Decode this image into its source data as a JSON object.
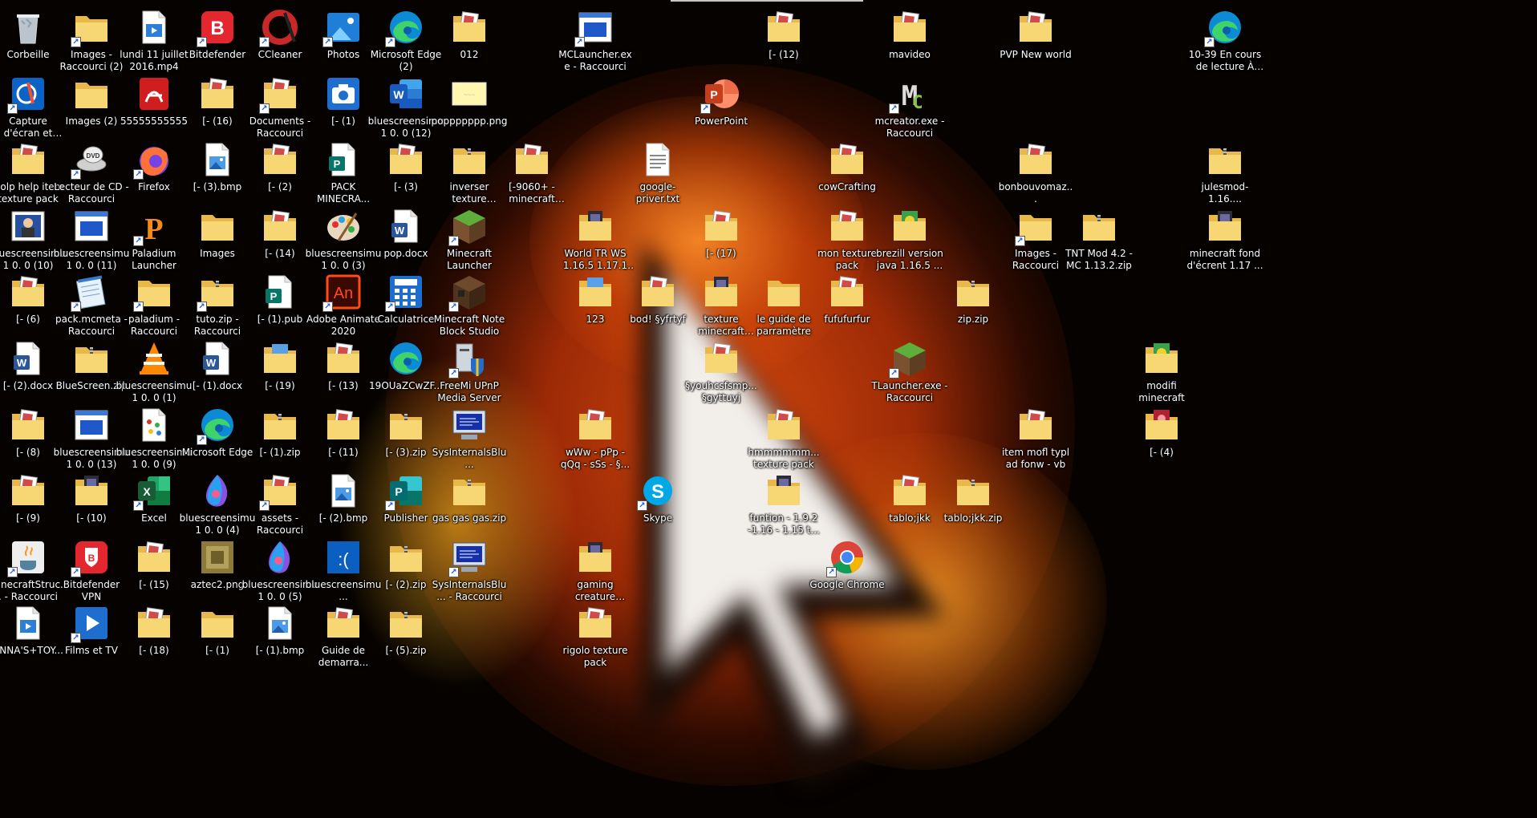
{
  "icons": [
    {
      "label": "Corbeille",
      "type": "recycle",
      "col": 0,
      "row": 0,
      "shortcut": false
    },
    {
      "label": "Images - Raccourci (2)",
      "type": "folder-img",
      "col": 1,
      "row": 0,
      "shortcut": true
    },
    {
      "label": "lundi 11 juillet 2016.mp4",
      "type": "video",
      "col": 2,
      "row": 0,
      "shortcut": false
    },
    {
      "label": "Bitdefender",
      "type": "bitdefender",
      "col": 3,
      "row": 0,
      "shortcut": true
    },
    {
      "label": "CCleaner",
      "type": "ccleaner",
      "col": 4,
      "row": 0,
      "shortcut": true
    },
    {
      "label": "Photos",
      "type": "photos",
      "col": 5,
      "row": 0,
      "shortcut": true
    },
    {
      "label": "Microsoft Edge (2)",
      "type": "edge",
      "col": 6,
      "row": 0,
      "shortcut": true
    },
    {
      "label": "012",
      "type": "folder-doc",
      "col": 7,
      "row": 0,
      "shortcut": false
    },
    {
      "label": "MCLauncher.exe - Raccourci",
      "type": "app-window",
      "col": 9,
      "row": 0,
      "shortcut": true
    },
    {
      "label": "[- (12)",
      "type": "folder-doc",
      "col": 12,
      "row": 0,
      "shortcut": false
    },
    {
      "label": "mavideo",
      "type": "folder-doc",
      "col": 14,
      "row": 0,
      "shortcut": false
    },
    {
      "label": "PVP New world",
      "type": "folder-doc",
      "col": 16,
      "row": 0,
      "shortcut": false
    },
    {
      "label": "10-39 En cours de lecture À re...",
      "type": "edge",
      "col": 19,
      "row": 0,
      "shortcut": true
    },
    {
      "label": "Capture d'écran et croquis",
      "type": "snip",
      "col": 0,
      "row": 1,
      "shortcut": true
    },
    {
      "label": "Images (2)",
      "type": "folder",
      "col": 1,
      "row": 1,
      "shortcut": false
    },
    {
      "label": "55555555555",
      "type": "pdf",
      "col": 2,
      "row": 1,
      "shortcut": false
    },
    {
      "label": "[- (16)",
      "type": "folder-doc",
      "col": 3,
      "row": 1,
      "shortcut": false
    },
    {
      "label": "Documents - Raccourci",
      "type": "folder-doc",
      "col": 4,
      "row": 1,
      "shortcut": true
    },
    {
      "label": "[- (1)",
      "type": "camera",
      "col": 5,
      "row": 1,
      "shortcut": false
    },
    {
      "label": "bluescreensimu 1 0. 0 (12)",
      "type": "word",
      "col": 6,
      "row": 1,
      "shortcut": false
    },
    {
      "label": "poppppppp.png",
      "type": "png-yellow",
      "col": 7,
      "row": 1,
      "shortcut": false
    },
    {
      "label": "PowerPoint",
      "type": "powerpoint",
      "col": 11,
      "row": 1,
      "shortcut": true
    },
    {
      "label": "mcreator.exe - Raccourci",
      "type": "mcreator",
      "col": 14,
      "row": 1,
      "shortcut": true
    },
    {
      "label": "wolp help item texture pack",
      "type": "folder-doc",
      "col": 0,
      "row": 2,
      "shortcut": false
    },
    {
      "label": "Lecteur de CD - Raccourci",
      "type": "dvd",
      "col": 1,
      "row": 2,
      "shortcut": true
    },
    {
      "label": "Firefox",
      "type": "firefox",
      "col": 2,
      "row": 2,
      "shortcut": true
    },
    {
      "label": "[- (3).bmp",
      "type": "image-file",
      "col": 3,
      "row": 2,
      "shortcut": false
    },
    {
      "label": "[- (2)",
      "type": "folder-doc",
      "col": 4,
      "row": 2,
      "shortcut": false
    },
    {
      "label": "PACK MINECRA...",
      "type": "publisher-doc",
      "col": 5,
      "row": 2,
      "shortcut": false
    },
    {
      "label": "[- (3)",
      "type": "folder-doc",
      "col": 6,
      "row": 2,
      "shortcut": false
    },
    {
      "label": "inverser texture pack.zip",
      "type": "zip",
      "col": 7,
      "row": 2,
      "shortcut": false
    },
    {
      "label": "[-9060+ - minecraft cras...",
      "type": "folder-doc",
      "col": 8,
      "row": 2,
      "shortcut": false
    },
    {
      "label": "google-priver.txt",
      "type": "text",
      "col": 10,
      "row": 2,
      "shortcut": false
    },
    {
      "label": "cowCrafting",
      "type": "folder-doc",
      "col": 13,
      "row": 2,
      "shortcut": false
    },
    {
      "label": "bonbouvomaz...",
      "type": "folder-doc",
      "col": 16,
      "row": 2,
      "shortcut": false
    },
    {
      "label": "julesmod-1.16....",
      "type": "zip",
      "col": 19,
      "row": 2,
      "shortcut": false
    },
    {
      "label": "bluescreensimu 1 0. 0 (10)",
      "type": "app-person",
      "col": 0,
      "row": 3,
      "shortcut": false
    },
    {
      "label": "bluescreensimu 1 0. 0 (11)",
      "type": "app-window",
      "col": 1,
      "row": 3,
      "shortcut": false
    },
    {
      "label": "Paladium Launcher",
      "type": "paladium",
      "col": 2,
      "row": 3,
      "shortcut": true
    },
    {
      "label": "Images",
      "type": "folder",
      "col": 3,
      "row": 3,
      "shortcut": false
    },
    {
      "label": "[- (14)",
      "type": "folder-doc",
      "col": 4,
      "row": 3,
      "shortcut": false
    },
    {
      "label": "bluescreensimu 1 0. 0 (3)",
      "type": "paint",
      "col": 5,
      "row": 3,
      "shortcut": false
    },
    {
      "label": "pop.docx",
      "type": "word-doc",
      "col": 6,
      "row": 3,
      "shortcut": false
    },
    {
      "label": "Minecraft Launcher",
      "type": "minecraft",
      "col": 7,
      "row": 3,
      "shortcut": true
    },
    {
      "label": "World TR WS 1.16.5 1.17.1 1...",
      "type": "folder-dark",
      "col": 9,
      "row": 3,
      "shortcut": false
    },
    {
      "label": "[- (17)",
      "type": "folder-doc",
      "col": 11,
      "row": 3,
      "shortcut": false
    },
    {
      "label": "mon texture pack",
      "type": "folder-doc",
      "col": 13,
      "row": 3,
      "shortcut": false
    },
    {
      "label": "brezill version java 1.16.5 ...",
      "type": "folder-green",
      "col": 14,
      "row": 3,
      "shortcut": false
    },
    {
      "label": "Images - Raccourci",
      "type": "folder-img",
      "col": 16,
      "row": 3,
      "shortcut": true
    },
    {
      "label": "TNT Mod 4.2 - MC 1.13.2.zip",
      "type": "zip",
      "col": 17,
      "row": 3,
      "shortcut": false
    },
    {
      "label": "minecraft fond d'écrent 1.17 ...",
      "type": "folder-dark",
      "col": 19,
      "row": 3,
      "shortcut": false
    },
    {
      "label": "[- (6)",
      "type": "folder-doc",
      "col": 0,
      "row": 4,
      "shortcut": false
    },
    {
      "label": "pack.mcmeta - Raccourci",
      "type": "notepad",
      "col": 1,
      "row": 4,
      "shortcut": true
    },
    {
      "label": "paladium - Raccourci",
      "type": "folder",
      "col": 2,
      "row": 4,
      "shortcut": true
    },
    {
      "label": "tuto.zip - Raccourci",
      "type": "zip",
      "col": 3,
      "row": 4,
      "shortcut": true
    },
    {
      "label": "[- (1).pub",
      "type": "publisher-doc",
      "col": 4,
      "row": 4,
      "shortcut": false
    },
    {
      "label": "Adobe Animate 2020",
      "type": "animate",
      "col": 5,
      "row": 4,
      "shortcut": true
    },
    {
      "label": "Calculatrice",
      "type": "calc",
      "col": 6,
      "row": 4,
      "shortcut": true
    },
    {
      "label": "Minecraft Note Block Studio",
      "type": "noteblock",
      "col": 7,
      "row": 4,
      "shortcut": true
    },
    {
      "label": "123",
      "type": "folder-blue",
      "col": 9,
      "row": 4,
      "shortcut": false
    },
    {
      "label": "bod! §yfrtyf",
      "type": "folder-doc",
      "col": 10,
      "row": 4,
      "shortcut": false
    },
    {
      "label": "texture minecraft modifi texture ...",
      "type": "folder-dark",
      "col": 11,
      "row": 4,
      "shortcut": false
    },
    {
      "label": "le guide de parramètre",
      "type": "folder",
      "col": 12,
      "row": 4,
      "shortcut": false
    },
    {
      "label": "fufufurfur",
      "type": "folder-doc",
      "col": 13,
      "row": 4,
      "shortcut": false
    },
    {
      "label": "zip.zip",
      "type": "zip",
      "col": 15,
      "row": 4,
      "shortcut": false
    },
    {
      "label": "[- (2).docx",
      "type": "word-doc",
      "col": 0,
      "row": 5,
      "shortcut": false
    },
    {
      "label": "BlueScreen.zip",
      "type": "zip",
      "col": 1,
      "row": 5,
      "shortcut": false
    },
    {
      "label": "bluescreensimu 1 0. 0 (1)",
      "type": "vlc",
      "col": 2,
      "row": 5,
      "shortcut": false
    },
    {
      "label": "[- (1).docx",
      "type": "word-doc",
      "col": 3,
      "row": 5,
      "shortcut": false
    },
    {
      "label": "[- (19)",
      "type": "folder-blue",
      "col": 4,
      "row": 5,
      "shortcut": false
    },
    {
      "label": "[- (13)",
      "type": "folder-doc",
      "col": 5,
      "row": 5,
      "shortcut": false
    },
    {
      "label": "19OUaZCwZF...",
      "type": "edge",
      "col": 6,
      "row": 5,
      "shortcut": false
    },
    {
      "label": "FreeMi UPnP Media Server",
      "type": "freemi",
      "col": 7,
      "row": 5,
      "shortcut": true
    },
    {
      "label": "§youhcsfsmp... §gyttuyj",
      "type": "folder-doc",
      "col": 11,
      "row": 5,
      "shortcut": false
    },
    {
      "label": "TLauncher.exe - Raccourci",
      "type": "minecraft",
      "col": 14,
      "row": 5,
      "shortcut": true
    },
    {
      "label": "modifi minecraft",
      "type": "folder-green",
      "col": 18,
      "row": 5,
      "shortcut": false
    },
    {
      "label": "[- (8)",
      "type": "folder-doc",
      "col": 0,
      "row": 6,
      "shortcut": false
    },
    {
      "label": "bluescreensimu 1 0. 0 (13)",
      "type": "app-window",
      "col": 1,
      "row": 6,
      "shortcut": false
    },
    {
      "label": "bluescreensimu 1 0. 0 (9)",
      "type": "pattern",
      "col": 2,
      "row": 6,
      "shortcut": false
    },
    {
      "label": "Microsoft Edge",
      "type": "edge",
      "col": 3,
      "row": 6,
      "shortcut": true
    },
    {
      "label": "[- (1).zip",
      "type": "zip",
      "col": 4,
      "row": 6,
      "shortcut": false
    },
    {
      "label": "[- (11)",
      "type": "folder-doc",
      "col": 5,
      "row": 6,
      "shortcut": false
    },
    {
      "label": "[- (3).zip",
      "type": "zip",
      "col": 6,
      "row": 6,
      "shortcut": false
    },
    {
      "label": "SysInternalsBlu...",
      "type": "sysint",
      "col": 7,
      "row": 6,
      "shortcut": false
    },
    {
      "label": "wWw - pPp - qQq - sSs - §...",
      "type": "folder-doc",
      "col": 9,
      "row": 6,
      "shortcut": false
    },
    {
      "label": "hmmmmmm... texture pack",
      "type": "folder-doc",
      "col": 12,
      "row": 6,
      "shortcut": false
    },
    {
      "label": "item mofl typl ad fonw - vb",
      "type": "folder-doc",
      "col": 16,
      "row": 6,
      "shortcut": false
    },
    {
      "label": "[- (4)",
      "type": "folder-red",
      "col": 18,
      "row": 6,
      "shortcut": false
    },
    {
      "label": "[- (9)",
      "type": "folder-doc",
      "col": 0,
      "row": 7,
      "shortcut": false
    },
    {
      "label": "[- (10)",
      "type": "folder-dark",
      "col": 1,
      "row": 7,
      "shortcut": false
    },
    {
      "label": "Excel",
      "type": "excel",
      "col": 2,
      "row": 7,
      "shortcut": true
    },
    {
      "label": "bluescreensimu 1 0. 0 (4)",
      "type": "paint3d",
      "col": 3,
      "row": 7,
      "shortcut": false
    },
    {
      "label": "assets - Raccourci",
      "type": "folder-doc",
      "col": 4,
      "row": 7,
      "shortcut": true
    },
    {
      "label": "[- (2).bmp",
      "type": "image-file",
      "col": 5,
      "row": 7,
      "shortcut": false
    },
    {
      "label": "Publisher",
      "type": "publisher",
      "col": 6,
      "row": 7,
      "shortcut": true
    },
    {
      "label": "gas gas gas.zip",
      "type": "zip",
      "col": 7,
      "row": 7,
      "shortcut": false
    },
    {
      "label": "Skype",
      "type": "skype",
      "col": 10,
      "row": 7,
      "shortcut": true
    },
    {
      "label": "funtion - 1.9.2 -1.16 - 1.15 t...",
      "type": "folder-dark",
      "col": 12,
      "row": 7,
      "shortcut": false
    },
    {
      "label": "tablo;jkk",
      "type": "folder-doc",
      "col": 14,
      "row": 7,
      "shortcut": false
    },
    {
      "label": "tablo;jkk.zip",
      "type": "zip",
      "col": 15,
      "row": 7,
      "shortcut": false
    },
    {
      "label": "MinecraftStruc... - Raccourci",
      "type": "java",
      "col": 0,
      "row": 8,
      "shortcut": true
    },
    {
      "label": "Bitdefender VPN",
      "type": "bitdefender-vpn",
      "col": 1,
      "row": 8,
      "shortcut": true
    },
    {
      "label": "[- (15)",
      "type": "folder-doc",
      "col": 2,
      "row": 8,
      "shortcut": false
    },
    {
      "label": "aztec2.png",
      "type": "png-olive",
      "col": 3,
      "row": 8,
      "shortcut": false
    },
    {
      "label": "bluescreensimu 1 0. 0 (5)",
      "type": "paint3d",
      "col": 4,
      "row": 8,
      "shortcut": false
    },
    {
      "label": "bluescreensimu...",
      "type": "bsod",
      "col": 5,
      "row": 8,
      "shortcut": false
    },
    {
      "label": "[- (2).zip",
      "type": "zip",
      "col": 6,
      "row": 8,
      "shortcut": false
    },
    {
      "label": "SysInternalsBlu... - Raccourci",
      "type": "sysint",
      "col": 7,
      "row": 8,
      "shortcut": true
    },
    {
      "label": "gaming creature texture pack",
      "type": "folder-dark",
      "col": 9,
      "row": 8,
      "shortcut": false
    },
    {
      "label": "Google Chrome",
      "type": "chrome",
      "col": 13,
      "row": 8,
      "shortcut": true
    },
    {
      "label": "ANNA'S+TOY...",
      "type": "video",
      "col": 0,
      "row": 9,
      "shortcut": false
    },
    {
      "label": "Films et TV",
      "type": "films",
      "col": 1,
      "row": 9,
      "shortcut": true
    },
    {
      "label": "[- (18)",
      "type": "folder-doc",
      "col": 2,
      "row": 9,
      "shortcut": false
    },
    {
      "label": "[- (1)",
      "type": "folder",
      "col": 3,
      "row": 9,
      "shortcut": false
    },
    {
      "label": "[- (1).bmp",
      "type": "image-file",
      "col": 4,
      "row": 9,
      "shortcut": false
    },
    {
      "label": "Guide de demarra...",
      "type": "folder-doc",
      "col": 5,
      "row": 9,
      "shortcut": false
    },
    {
      "label": "[- (5).zip",
      "type": "zip",
      "col": 6,
      "row": 9,
      "shortcut": false
    },
    {
      "label": "rigolo texture pack",
      "type": "folder-doc",
      "col": 9,
      "row": 9,
      "shortcut": false
    }
  ]
}
